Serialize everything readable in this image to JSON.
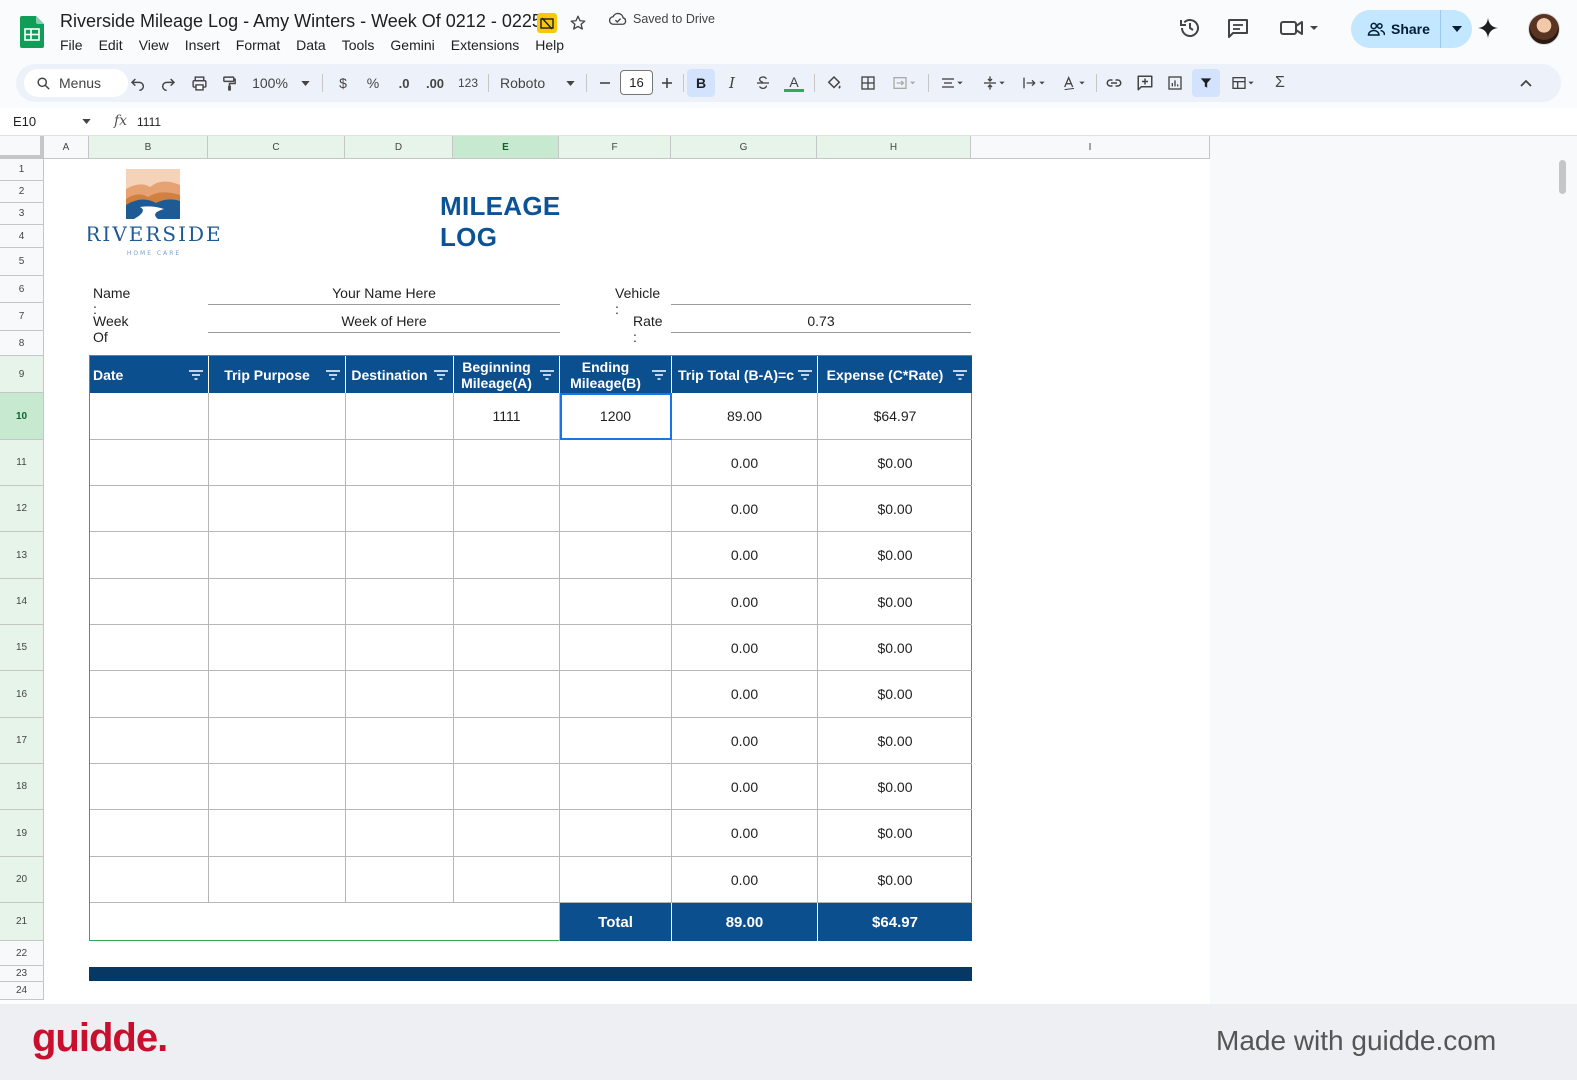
{
  "window": {
    "title": "Riverside Mileage Log - Amy Winters - Week Of 0212 - 0225",
    "saved_status": "Saved to Drive",
    "share_label": "Share"
  },
  "menu": [
    "File",
    "Edit",
    "View",
    "Insert",
    "Format",
    "Data",
    "Tools",
    "Gemini",
    "Extensions",
    "Help"
  ],
  "toolbar": {
    "search_label": "Menus",
    "zoom": "100%",
    "currency": "$",
    "percent": "%",
    "decrease_decimal": ".0",
    "increase_decimal": ".00",
    "number_format": "123",
    "font": "Roboto",
    "font_size": "16",
    "bold": "B",
    "italic": "I",
    "text_color": "A",
    "sum": "Σ"
  },
  "formula_bar": {
    "cell_ref": "E10",
    "fx": "fx",
    "value": "1111"
  },
  "columns": [
    "A",
    "B",
    "C",
    "D",
    "E",
    "F",
    "G",
    "H",
    "I"
  ],
  "rows": [
    "1",
    "2",
    "3",
    "4",
    "5",
    "6",
    "7",
    "8",
    "9",
    "10",
    "11",
    "12",
    "13",
    "14",
    "15",
    "16",
    "17",
    "18",
    "19",
    "20",
    "21",
    "22",
    "23",
    "24"
  ],
  "sheet": {
    "title": "MILEAGE LOG",
    "logo_text": "RIVERSIDE",
    "logo_subtext": "HOME CARE",
    "name_label": "Name :",
    "name_value": "Your Name Here",
    "week_label": "Week Of",
    "week_value": "Week of Here",
    "vehicle_label": "Vehicle :",
    "vehicle_value": "",
    "rate_label": "Rate :",
    "rate_value": "0.73",
    "headers": [
      "Date",
      "Trip Purpose",
      "Destination",
      "Beginning Mileage(A)",
      "Ending Mileage(B)",
      "Trip Total (B-A)=c",
      "Expense (C*Rate)"
    ],
    "rows": [
      [
        "",
        "",
        "",
        "1111",
        "1200",
        "89.00",
        "$64.97"
      ],
      [
        "",
        "",
        "",
        "",
        "",
        "0.00",
        "$0.00"
      ],
      [
        "",
        "",
        "",
        "",
        "",
        "0.00",
        "$0.00"
      ],
      [
        "",
        "",
        "",
        "",
        "",
        "0.00",
        "$0.00"
      ],
      [
        "",
        "",
        "",
        "",
        "",
        "0.00",
        "$0.00"
      ],
      [
        "",
        "",
        "",
        "",
        "",
        "0.00",
        "$0.00"
      ],
      [
        "",
        "",
        "",
        "",
        "",
        "0.00",
        "$0.00"
      ],
      [
        "",
        "",
        "",
        "",
        "",
        "0.00",
        "$0.00"
      ],
      [
        "",
        "",
        "",
        "",
        "",
        "0.00",
        "$0.00"
      ],
      [
        "",
        "",
        "",
        "",
        "",
        "0.00",
        "$0.00"
      ],
      [
        "",
        "",
        "",
        "",
        "",
        "0.00",
        "$0.00"
      ]
    ],
    "total_label": "Total",
    "total_trip": "89.00",
    "total_expense": "$64.97"
  },
  "footer": {
    "brand": "guidde.",
    "made_with": "Made with guidde.com"
  },
  "colors": {
    "header_blue": "#0b4f8f",
    "title_blue": "#0b5394",
    "selection_green": "#c7e9d0",
    "active_blue": "#1a73e8",
    "guidde_red": "#c8102e"
  }
}
